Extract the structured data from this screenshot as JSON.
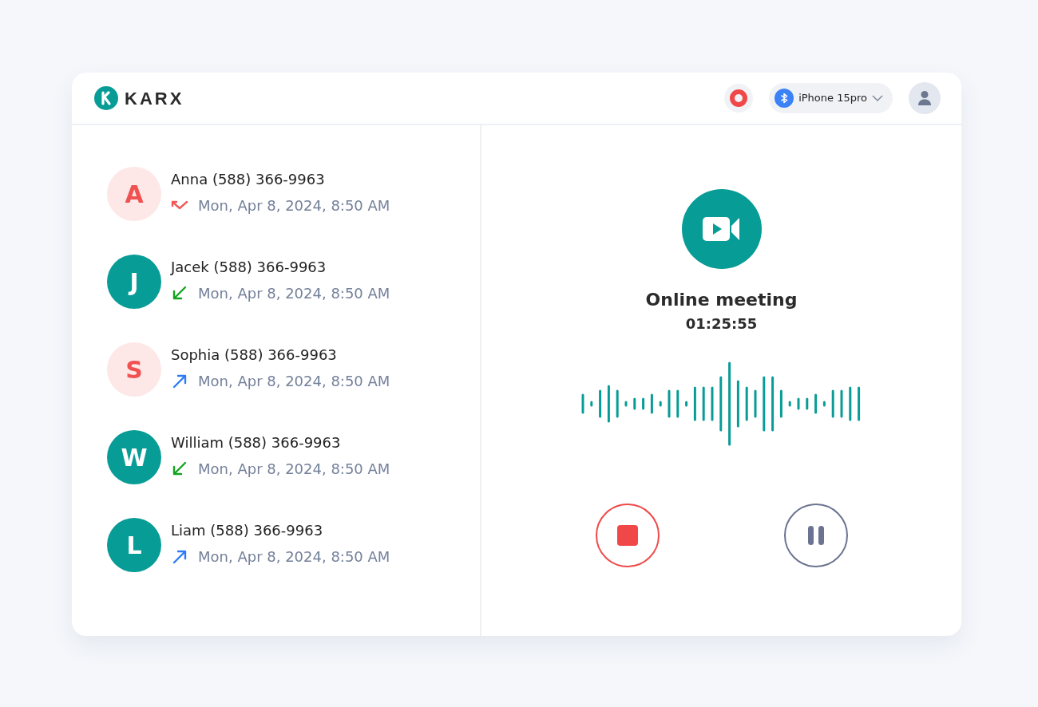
{
  "brand": {
    "name": "KARX"
  },
  "header": {
    "recording": true,
    "device": {
      "label": "iPhone 15pro"
    }
  },
  "calls": [
    {
      "initial": "A",
      "color": "#fde7e7",
      "title": "Anna (588) 366-9963",
      "kind": "missed",
      "time": "Mon, Apr 8, 2024, 8:50 AM"
    },
    {
      "initial": "J",
      "color": "#089c96",
      "title": "Jacek (588) 366-9963",
      "kind": "incoming",
      "time": "Mon, Apr 8, 2024, 8:50 AM"
    },
    {
      "initial": "S",
      "color": "#fde7e7",
      "title": "Sophia (588) 366-9963",
      "kind": "outgoing",
      "time": "Mon, Apr 8, 2024, 8:50 AM"
    },
    {
      "initial": "W",
      "color": "#089c96",
      "title": "William (588) 366-9963",
      "kind": "incoming",
      "time": "Mon, Apr 8, 2024, 8:50 AM"
    },
    {
      "initial": "L",
      "color": "#089c96",
      "title": "Liam (588) 366-9963",
      "kind": "outgoing",
      "time": "Mon, Apr 8, 2024, 8:50 AM"
    }
  ],
  "meeting": {
    "title": "Online meeting",
    "duration": "01:25:55"
  }
}
